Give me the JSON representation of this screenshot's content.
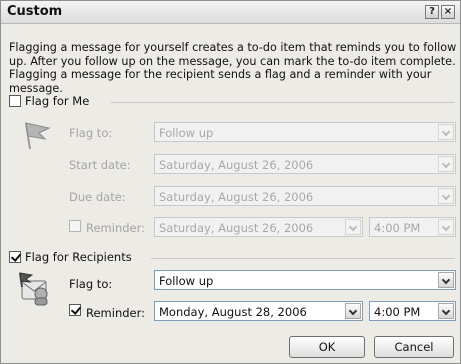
{
  "dialog": {
    "title": "Custom",
    "help_glyph": "?",
    "close_glyph": "×",
    "description": "Flagging a message for yourself creates a to-do item that reminds you to follow up. After you follow up on the message, you can mark the to-do item complete. Flagging a message for the recipient sends a flag and a reminder with your message."
  },
  "flag_for_me": {
    "label": "Flag for Me",
    "checked": false,
    "flag_to_label": "Flag to:",
    "flag_to_value": "Follow up",
    "start_date_label": "Start date:",
    "start_date_value": "Saturday, August 26, 2006",
    "due_date_label": "Due date:",
    "due_date_value": "Saturday, August 26, 2006",
    "reminder_label": "Reminder:",
    "reminder_checked": false,
    "reminder_date": "Saturday, August 26, 2006",
    "reminder_time": "4:00 PM"
  },
  "flag_for_recipients": {
    "label": "Flag for Recipients",
    "checked": true,
    "flag_to_label": "Flag to:",
    "flag_to_value": "Follow up",
    "reminder_label": "Reminder:",
    "reminder_checked": true,
    "reminder_date": "Monday, August 28, 2006",
    "reminder_time": "4:00 PM"
  },
  "buttons": {
    "ok": "OK",
    "cancel": "Cancel"
  },
  "icons": {
    "flag": "flag-icon",
    "recipients": "recipients-flag-icon"
  }
}
